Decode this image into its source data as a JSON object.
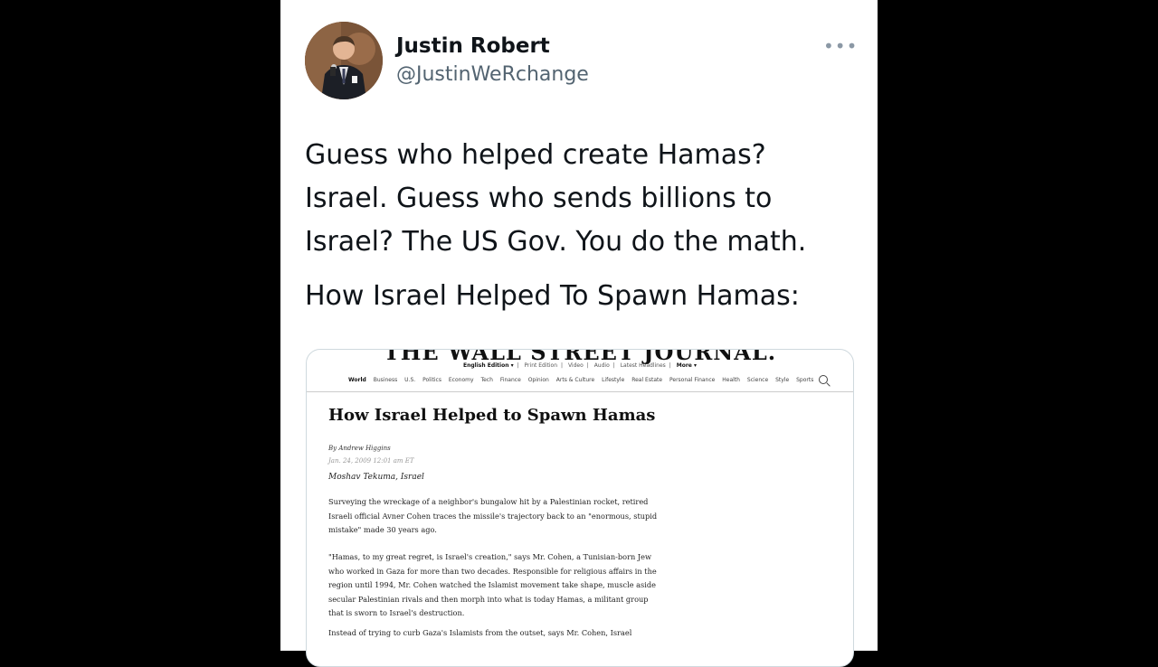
{
  "tweet": {
    "author_name": "Justin Robert",
    "author_handle": "@JustinWeRchange",
    "more_icon": "more-horizontal-icon",
    "text_paragraph_1": "Guess who helped create Hamas? Israel. Guess who sends billions to Israel? The US Gov. You do the math.",
    "text_paragraph_2": "How Israel Helped To Spawn Hamas:"
  },
  "article_image": {
    "masthead": "THE WALL STREET JOURNAL.",
    "subnav": [
      "English Edition ▾",
      "Print Edition",
      "Video",
      "Audio",
      "Latest Headlines",
      "More ▾"
    ],
    "nav": [
      "World",
      "Business",
      "U.S.",
      "Politics",
      "Economy",
      "Tech",
      "Finance",
      "Opinion",
      "Arts & Culture",
      "Lifestyle",
      "Real Estate",
      "Personal Finance",
      "Health",
      "Science",
      "Style",
      "Sports"
    ],
    "search_icon": "search-icon",
    "headline": "How Israel Helped to Spawn Hamas",
    "byline": "By Andrew Higgins",
    "date": "Jan. 24, 2009 12:01 am ET",
    "dateline": "Moshav Tekuma, Israel",
    "paragraph_1": "Surveying the wreckage of a neighbor's bungalow hit by a Palestinian rocket, retired Israeli official Avner Cohen traces the missile's trajectory back to an \"enormous, stupid mistake\" made 30 years ago.",
    "paragraph_2": "\"Hamas, to my great regret, is Israel's creation,\" says Mr. Cohen, a Tunisian-born Jew who worked in Gaza for more than two decades. Responsible for religious affairs in the region until 1994, Mr. Cohen watched the Islamist movement take shape, muscle aside secular Palestinian rivals and then morph into what is today Hamas, a militant group that is sworn to Israel's destruction.",
    "paragraph_3": "Instead of trying to curb Gaza's Islamists from the outset, says Mr. Cohen, Israel"
  },
  "colors": {
    "background": "#000000",
    "card": "#ffffff",
    "text": "#0f1419",
    "secondary_text": "#536471"
  }
}
